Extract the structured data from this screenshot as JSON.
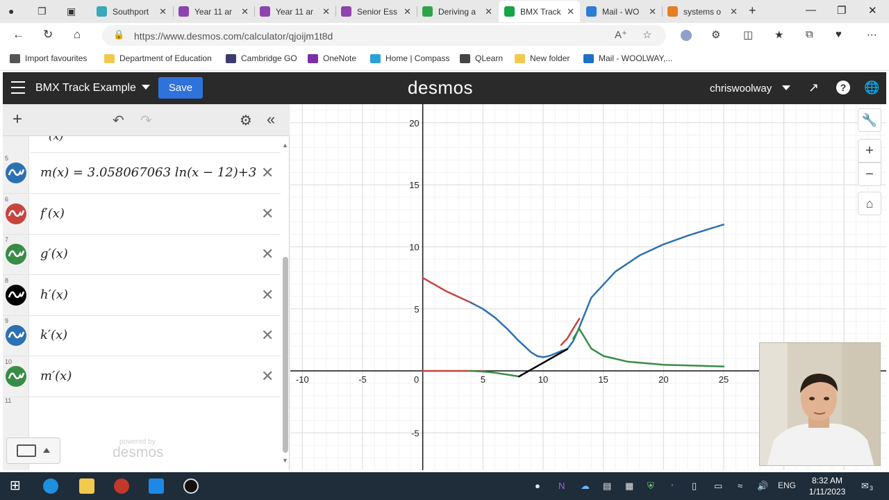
{
  "browser": {
    "tabs": [
      {
        "title": "Southport",
        "color": "#3aa9b9",
        "active": false
      },
      {
        "title": "Year 11 ar",
        "color": "#8e44ad",
        "active": false
      },
      {
        "title": "Year 11 ar",
        "color": "#8e44ad",
        "active": false
      },
      {
        "title": "Senior Ess",
        "color": "#8e44ad",
        "active": false
      },
      {
        "title": "Deriving a",
        "color": "#2fa34a",
        "active": false
      },
      {
        "title": "BMX Track",
        "color": "#17a34a",
        "active": true
      },
      {
        "title": "Mail - WO",
        "color": "#2b7cd3",
        "active": false
      },
      {
        "title": "systems o",
        "color": "#e67e22",
        "active": false
      }
    ],
    "url": "https://www.desmos.com/calculator/qjoijm1t8d",
    "favourites": [
      {
        "label": "Import favourites",
        "icon": "import-icon"
      },
      {
        "label": "Department of Education",
        "icon": "folder-icon"
      },
      {
        "label": "Cambridge GO",
        "icon": "cambridge-icon"
      },
      {
        "label": "OneNote",
        "icon": "onenote-icon"
      },
      {
        "label": "Home | Compass",
        "icon": "compass-icon"
      },
      {
        "label": "QLearn",
        "icon": "qlearn-icon"
      },
      {
        "label": "New folder",
        "icon": "folder-icon"
      },
      {
        "label": "Mail - WOOLWAY,...",
        "icon": "outlook-icon"
      }
    ]
  },
  "desmos": {
    "graph_title": "BMX Track Example",
    "save_label": "Save",
    "logo": "desmos",
    "username": "chriswoolway",
    "powered_by": "powered by",
    "powered_logo": "desmos"
  },
  "expressions": [
    {
      "num": "5",
      "latex": "m(x) = 3.058067063 ln(x − 12)+3",
      "color": "#2d70b3"
    },
    {
      "num": "6",
      "latex": "f′(x)",
      "color": "#c74440"
    },
    {
      "num": "7",
      "latex": "g′(x)",
      "color": "#388c46"
    },
    {
      "num": "8",
      "latex": "h′(x)",
      "color": "#000000"
    },
    {
      "num": "9",
      "latex": "k′(x)",
      "color": "#2d70b3"
    },
    {
      "num": "10",
      "latex": "m′(x)",
      "color": "#388c46"
    }
  ],
  "next_expression_num": "11",
  "graph_axes": {
    "x_ticks": [
      "-10",
      "-5",
      "0",
      "5",
      "10",
      "15",
      "20",
      "25"
    ],
    "y_ticks": [
      "-5",
      "5",
      "10",
      "15",
      "20"
    ],
    "xlim": [
      -11,
      38.5
    ],
    "ylim": [
      -8,
      21.5
    ]
  },
  "chart_data": {
    "type": "line",
    "series": [
      {
        "color": "#c74440",
        "points": [
          [
            0,
            7.5
          ],
          [
            2,
            6.4
          ],
          [
            4,
            5.5
          ],
          [
            4.2,
            5.4
          ]
        ]
      },
      {
        "color": "#2d70b3",
        "points": [
          [
            4,
            5.5
          ],
          [
            5,
            5.0
          ],
          [
            6,
            4.3
          ],
          [
            7,
            3.4
          ],
          [
            8,
            2.4
          ],
          [
            9,
            1.5
          ],
          [
            9.5,
            1.2
          ],
          [
            10,
            1.1
          ],
          [
            10.5,
            1.2
          ],
          [
            11,
            1.4
          ],
          [
            11.5,
            1.6
          ],
          [
            12,
            1.75
          ],
          [
            12.5,
            2.4
          ],
          [
            13,
            3.5
          ],
          [
            14,
            5.9
          ],
          [
            16,
            8.0
          ],
          [
            18,
            9.3
          ],
          [
            20,
            10.2
          ],
          [
            22,
            10.9
          ],
          [
            24,
            11.5
          ],
          [
            25,
            11.8
          ]
        ]
      },
      {
        "color": "#c74440",
        "points": [
          [
            11.5,
            2.1
          ],
          [
            12,
            2.6
          ],
          [
            12.5,
            3.4
          ],
          [
            13,
            4.2
          ]
        ]
      },
      {
        "color": "#388c46",
        "points": [
          [
            12.5,
            2.6
          ],
          [
            13,
            3.4
          ],
          [
            14,
            1.8
          ],
          [
            15,
            1.2
          ],
          [
            17,
            0.75
          ],
          [
            20,
            0.5
          ],
          [
            25,
            0.35
          ]
        ]
      },
      {
        "color": "#c74440",
        "points": [
          [
            0,
            0
          ],
          [
            4,
            0
          ],
          [
            5,
            0
          ]
        ]
      },
      {
        "color": "#388c46",
        "points": [
          [
            4,
            0
          ],
          [
            5,
            -0.05
          ],
          [
            6,
            -0.15
          ],
          [
            7,
            -0.3
          ],
          [
            8,
            -0.45
          ]
        ]
      },
      {
        "color": "#000000",
        "points": [
          [
            8,
            -0.45
          ],
          [
            12,
            1.75
          ]
        ]
      }
    ]
  },
  "taskbar": {
    "lang": "ENG",
    "time": "8:32 AM",
    "date": "1/11/2023",
    "notifications": "3"
  }
}
